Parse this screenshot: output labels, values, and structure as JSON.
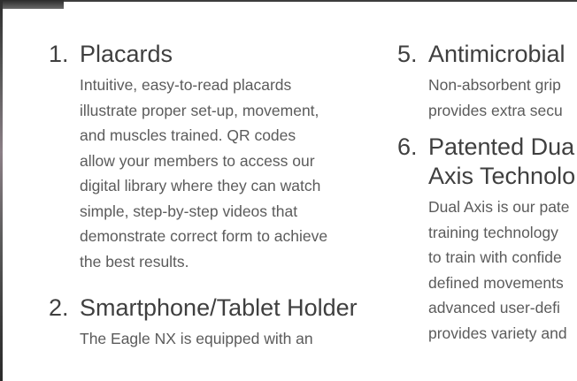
{
  "features_left": [
    {
      "number": "1.",
      "title": "Placards",
      "description": "Intuitive, easy-to-read placards\nillustrate proper set-up, movement,\nand muscles trained. QR codes\nallow your members to access our\ndigital library where they can watch\nsimple, step-by-step videos that\ndemonstrate correct form to achieve\nthe best results."
    },
    {
      "number": "2.",
      "title": "Smartphone/Tablet Holder",
      "description": "The Eagle NX is equipped with an"
    }
  ],
  "features_right": [
    {
      "number": "5.",
      "title": "Antimicrobial",
      "description": "Non-absorbent grip\nprovides extra secu"
    },
    {
      "number": "6.",
      "title": "Patented Dua\nAxis Technolo",
      "description": "Dual Axis is our pate\ntraining technology\nto train with confide\ndefined movements\nadvanced user-defi\nprovides variety and"
    }
  ]
}
